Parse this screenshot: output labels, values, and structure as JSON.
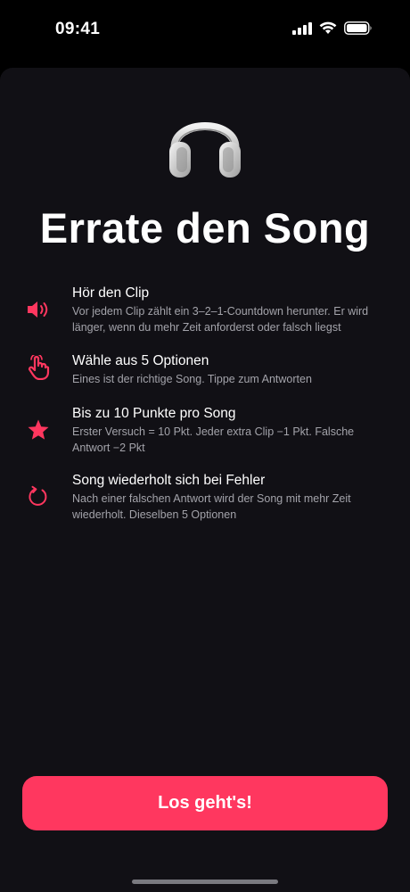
{
  "status_bar": {
    "time": "09:41"
  },
  "screen": {
    "title": "Errate den Song",
    "hero_icon": "headphones-icon",
    "accent": "#ff375f"
  },
  "rules": [
    {
      "icon": "speaker-icon",
      "title": "Hör den Clip",
      "desc": "Vor jedem Clip zählt ein 3–2–1-Countdown herunter. Er wird länger, wenn du mehr Zeit anforderst oder falsch liegst"
    },
    {
      "icon": "tap-hand-icon",
      "title": "Wähle aus 5 Optionen",
      "desc": "Eines ist der richtige Song. Tippe zum Antworten"
    },
    {
      "icon": "star-icon",
      "title": "Bis zu 10 Punkte pro Song",
      "desc": "Erster Versuch = 10 Pkt. Jeder extra Clip −1 Pkt. Falsche Antwort −2 Pkt"
    },
    {
      "icon": "retry-icon",
      "title": "Song wiederholt sich bei Fehler",
      "desc": "Nach einer falschen Antwort wird der Song mit mehr Zeit wiederholt. Dieselben 5 Optionen"
    }
  ],
  "cta": {
    "label": "Los geht's!"
  }
}
